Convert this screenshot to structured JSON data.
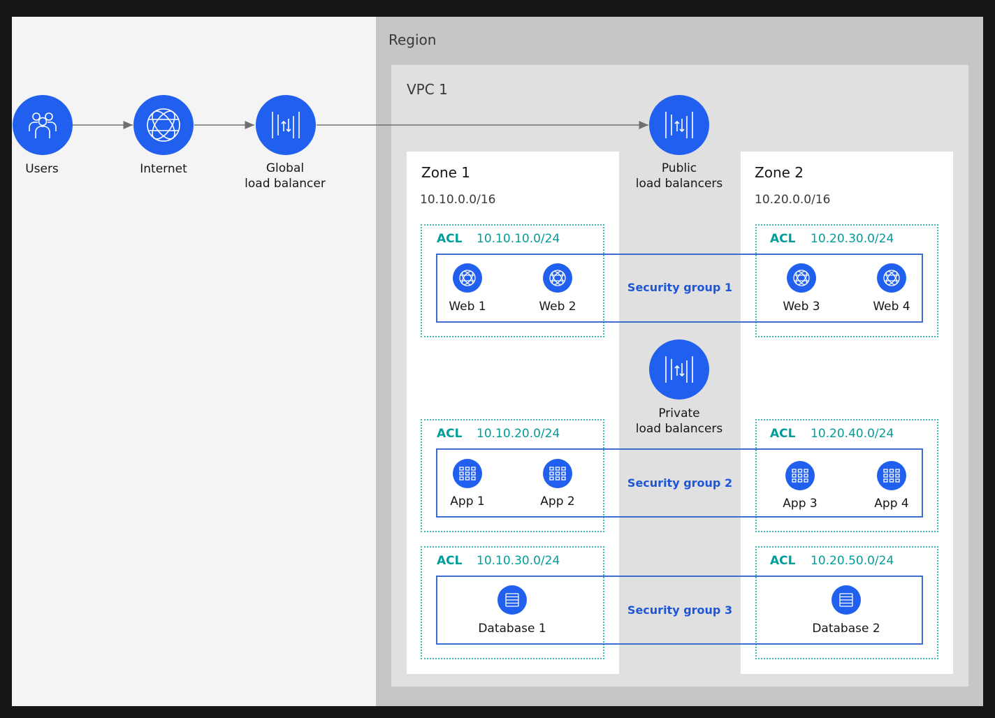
{
  "external": {
    "users_label": "Users",
    "internet_label": "Internet",
    "global_lb_label_1": "Global",
    "global_lb_label_2": "load balancer"
  },
  "region": {
    "label": "Region"
  },
  "vpc": {
    "label": "VPC 1",
    "public_lb_label_1": "Public",
    "public_lb_label_2": "load balancers",
    "private_lb_label_1": "Private",
    "private_lb_label_2": "load balancers"
  },
  "zones": [
    {
      "title": "Zone 1",
      "cidr": "10.10.0.0/16",
      "subnets": [
        {
          "acl": "ACL",
          "cidr": "10.10.10.0/24"
        },
        {
          "acl": "ACL",
          "cidr": "10.10.20.0/24"
        },
        {
          "acl": "ACL",
          "cidr": "10.10.30.0/24"
        }
      ]
    },
    {
      "title": "Zone 2",
      "cidr": "10.20.0.0/16",
      "subnets": [
        {
          "acl": "ACL",
          "cidr": "10.20.30.0/24"
        },
        {
          "acl": "ACL",
          "cidr": "10.20.40.0/24"
        },
        {
          "acl": "ACL",
          "cidr": "10.20.50.0/24"
        }
      ]
    }
  ],
  "security_groups": [
    "Security group 1",
    "Security group 2",
    "Security group 3"
  ],
  "nodes": {
    "web1": "Web 1",
    "web2": "Web 2",
    "web3": "Web 3",
    "web4": "Web 4",
    "app1": "App 1",
    "app2": "App 2",
    "app3": "App 3",
    "app4": "App 4",
    "db1": "Database 1",
    "db2": "Database 2"
  },
  "colors": {
    "icon_blue": "#2160ee",
    "acl_teal": "#009d9a",
    "security_group_blue": "#1f56d6"
  },
  "icons": {
    "users": "users-icon",
    "internet": "globe-icon",
    "load_balancer": "load-balancer-icon",
    "web": "globe-icon",
    "app": "application-icon",
    "database": "database-icon"
  }
}
